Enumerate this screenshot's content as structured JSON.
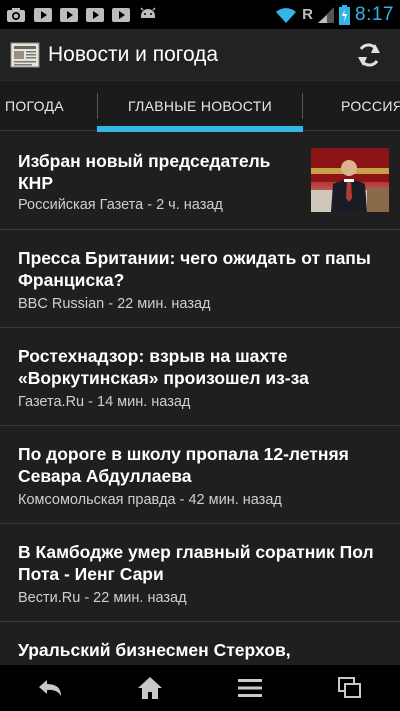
{
  "status_bar": {
    "time": "8:17",
    "roaming_indicator": "R",
    "notification_icons": [
      "camera-icon",
      "youtube-icon",
      "youtube-icon",
      "youtube-icon",
      "youtube-icon",
      "android-icon"
    ],
    "accent_color": "#33b5e5"
  },
  "action_bar": {
    "title": "Новости и погода",
    "refresh_icon": "refresh-icon"
  },
  "tabs": [
    {
      "label": "ПОГОДА"
    },
    {
      "label": "ГЛАВНЫЕ НОВОСТИ",
      "selected": true
    },
    {
      "label": "РОССИЯ"
    }
  ],
  "news": [
    {
      "title": "Избран новый председатель КНР",
      "meta": "Российская Газета - 2 ч. назад",
      "has_thumbnail": true
    },
    {
      "title": "Пресса Британии: чего ожидать от папы Франциска?",
      "meta": "BBC Russian - 22 мин. назад"
    },
    {
      "title": "Ростехнадзор: взрыв на шахте «Воркутинская» произошел из-за",
      "meta": "Газета.Ru - 14 мин. назад"
    },
    {
      "title": "По дороге в школу пропала 12-летняя Севара Абдуллаева",
      "meta": "Комсомольская правда - 42 мин. назад"
    },
    {
      "title": "В Камбодже умер главный соратник Пол Пота - Иенг Сари",
      "meta": "Вести.Ru - 22 мин. назад"
    },
    {
      "title": "Уральский бизнесмен Стерхов,",
      "meta": ""
    }
  ],
  "nav_bar": {
    "buttons": [
      "back-icon",
      "home-icon",
      "menu-icon",
      "recent-apps-icon"
    ]
  }
}
